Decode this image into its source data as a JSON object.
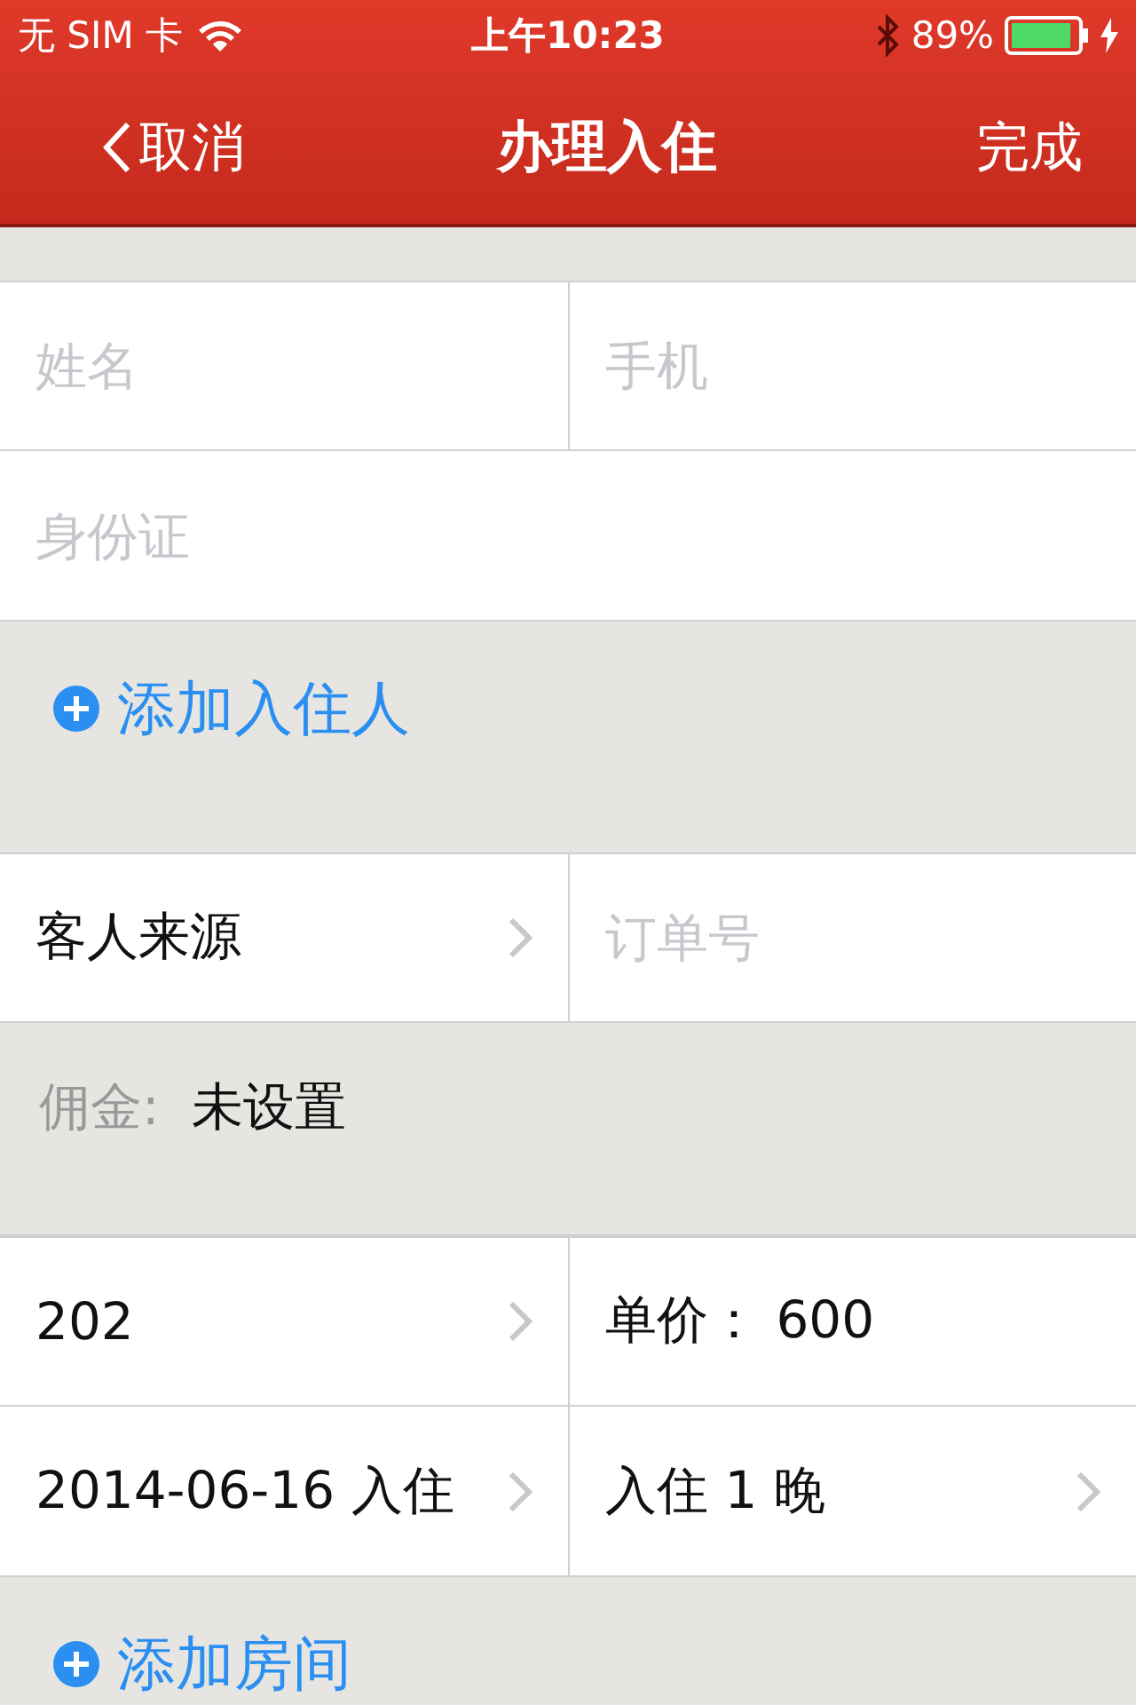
{
  "status_bar": {
    "carrier": "无 SIM 卡",
    "time": "上午10:23",
    "battery": "89%"
  },
  "nav": {
    "back": "取消",
    "title": "办理入住",
    "done": "完成"
  },
  "sections": [
    {
      "kind": "cells",
      "cells": [
        {
          "placeholder": "姓名",
          "chevron": false
        },
        {
          "placeholder": "手机",
          "chevron": false
        }
      ]
    },
    {
      "kind": "cells",
      "cells": [
        {
          "placeholder": "身份证",
          "chevron": false
        }
      ]
    },
    {
      "kind": "action",
      "text": "添加入住人"
    },
    {
      "kind": "cells",
      "cells": [
        {
          "value": "客人来源",
          "chevron": true
        },
        {
          "placeholder": "订单号",
          "chevron": false
        }
      ]
    },
    {
      "kind": "note",
      "label": "佣金:",
      "value": "未设置"
    },
    {
      "kind": "cells",
      "cells": [
        {
          "value": "202",
          "chevron": true
        },
        {
          "value": "单价： 600",
          "chevron": false
        }
      ]
    },
    {
      "kind": "cells",
      "cells": [
        {
          "value": "2014-06-16 入住",
          "chevron": true
        },
        {
          "value": "入住 1 晚",
          "chevron": true
        }
      ]
    },
    {
      "kind": "action",
      "text": "添加房间"
    }
  ]
}
